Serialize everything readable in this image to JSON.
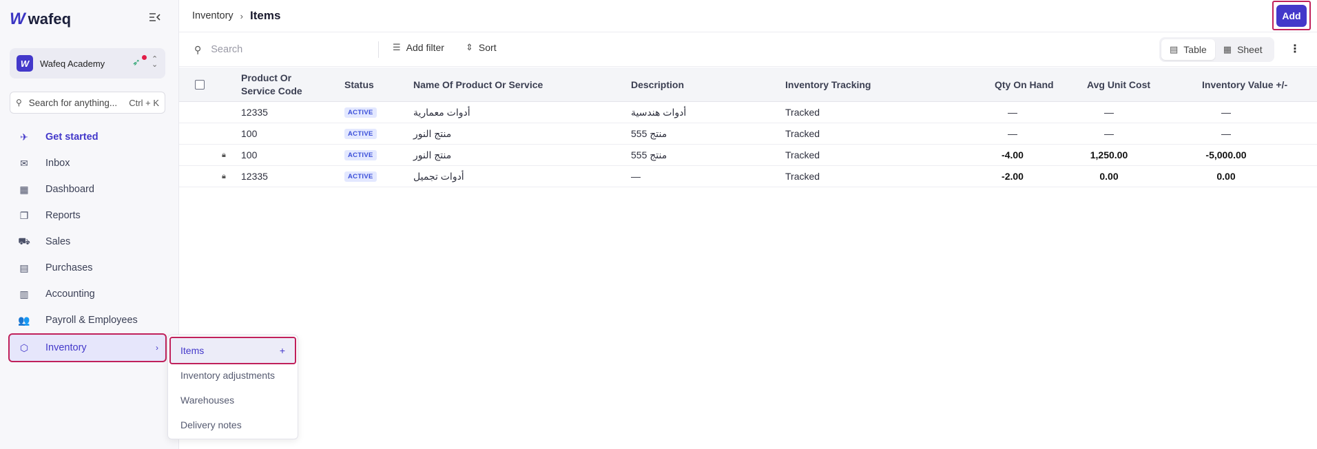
{
  "brand": {
    "logo_mark": "W",
    "name": "wafeq"
  },
  "org": {
    "avatar_letter": "W",
    "name": "Wafeq Academy"
  },
  "sidebar_search": {
    "placeholder": "Search for anything...",
    "shortcut": "Ctrl + K"
  },
  "nav": [
    {
      "label": "Get started",
      "icon": "rocket-icon"
    },
    {
      "label": "Inbox",
      "icon": "inbox-icon"
    },
    {
      "label": "Dashboard",
      "icon": "dashboard-icon"
    },
    {
      "label": "Reports",
      "icon": "reports-icon"
    },
    {
      "label": "Sales",
      "icon": "cart-icon"
    },
    {
      "label": "Purchases",
      "icon": "receipt-icon"
    },
    {
      "label": "Accounting",
      "icon": "ledger-icon"
    },
    {
      "label": "Payroll & Employees",
      "icon": "people-icon"
    },
    {
      "label": "Inventory",
      "icon": "box-icon"
    }
  ],
  "submenu": [
    {
      "label": "Items"
    },
    {
      "label": "Inventory adjustments"
    },
    {
      "label": "Warehouses"
    },
    {
      "label": "Delivery notes"
    }
  ],
  "breadcrumb": {
    "parent": "Inventory",
    "current": "Items"
  },
  "header": {
    "add_label": "Add"
  },
  "toolbar": {
    "search_placeholder": "Search",
    "add_filter": "Add filter",
    "sort": "Sort",
    "view_table": "Table",
    "view_sheet": "Sheet"
  },
  "table": {
    "columns": [
      "Product Or Service Code",
      "Status",
      "Name Of Product Or Service",
      "Description",
      "Inventory Tracking",
      "Qty On Hand",
      "Avg Unit Cost",
      "Inventory Value +/-"
    ],
    "rows": [
      {
        "locked": false,
        "code": "12335",
        "status": "ACTIVE",
        "name": "أدوات معمارية",
        "description": "أدوات هندسية",
        "tracking": "Tracked",
        "qty": "—",
        "avg": "—",
        "value": "—"
      },
      {
        "locked": false,
        "code": "100",
        "status": "ACTIVE",
        "name": "منتج النور",
        "description": "منتج 555",
        "tracking": "Tracked",
        "qty": "—",
        "avg": "—",
        "value": "—"
      },
      {
        "locked": true,
        "code": "100",
        "status": "ACTIVE",
        "name": "منتج النور",
        "description": "منتج 555",
        "tracking": "Tracked",
        "qty": "-4.00",
        "avg": "1,250.00",
        "value": "-5,000.00"
      },
      {
        "locked": true,
        "code": "12335",
        "status": "ACTIVE",
        "name": "أدوات تجميل",
        "description": "—",
        "tracking": "Tracked",
        "qty": "-2.00",
        "avg": "0.00",
        "value": "0.00"
      }
    ]
  },
  "colors": {
    "accent": "#4338ca",
    "highlight": "#c0205a",
    "sidebar_bg": "#f7f7fa",
    "badge_bg": "#e3e8ff"
  }
}
